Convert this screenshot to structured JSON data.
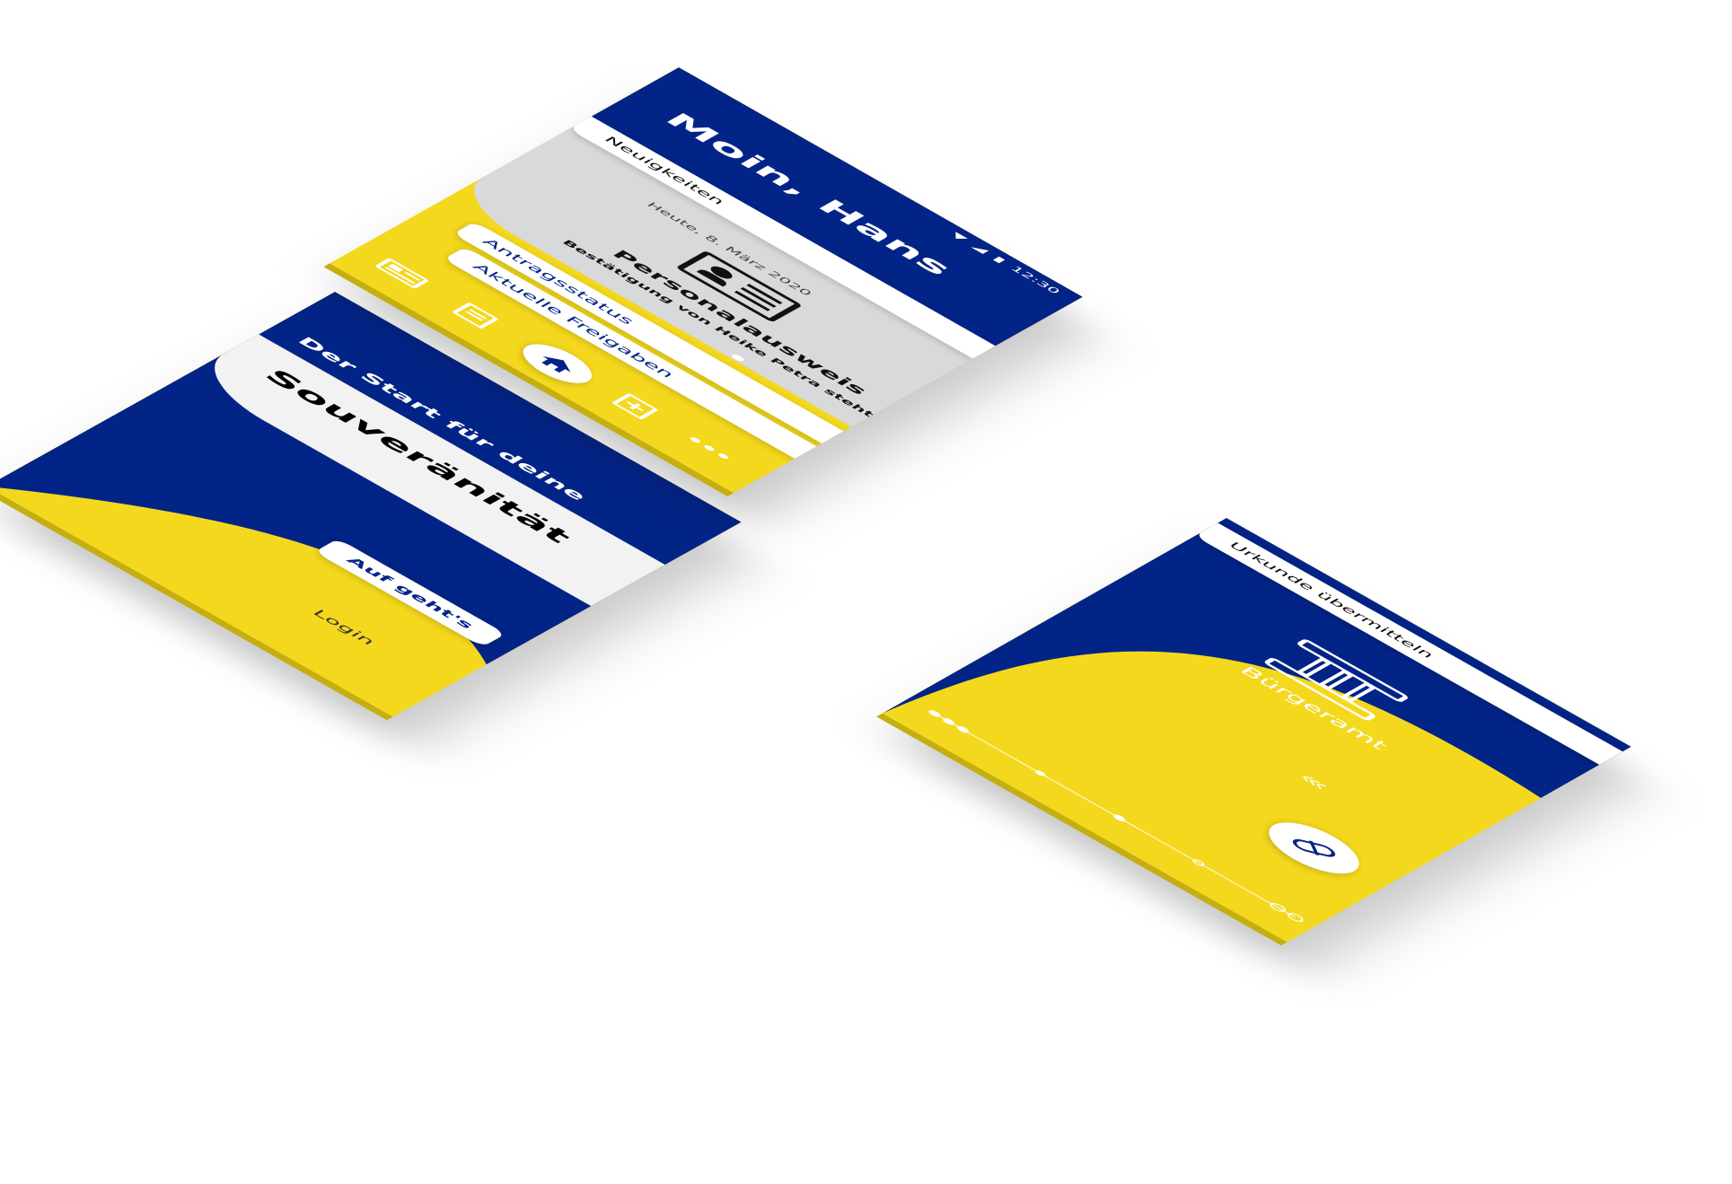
{
  "onboarding": {
    "subtitle": "Der Start für deine",
    "headline": "Souveränität",
    "start_button": "Auf geht's",
    "login_link": "Login"
  },
  "home": {
    "status_bar": {
      "time": "12:30"
    },
    "greeting": "Moin, Hans",
    "news_tab": "Neuigkeiten",
    "news_card": {
      "date": "Heute, 8. März 2020",
      "title": "Personalausweis",
      "subtitle": "Bestätigung von Heike Petra steht aus"
    },
    "status_tab": "Antragsstatus",
    "releases_tab": "Aktuelle Freigaben"
  },
  "transfer": {
    "header_tab": "Urkunde übermitteln",
    "office_label": "Bürgeramt"
  },
  "colors": {
    "primary_blue": "#032487",
    "accent_yellow": "#f4d81d",
    "card_gray": "#d8d9db"
  },
  "icons": {
    "id_card": "id-card-icon",
    "home": "home-icon",
    "documents": "documents-icon",
    "dashboard": "dashboard-icon",
    "add_document": "add-document-icon",
    "more": "more-icon",
    "building": "building-icon",
    "pills": "pill-icon",
    "chevrons": "chevron-left-icon"
  }
}
